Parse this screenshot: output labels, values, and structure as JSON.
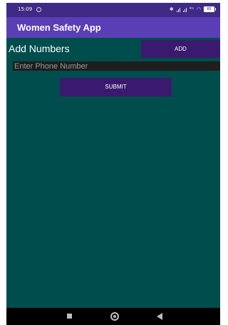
{
  "status_bar": {
    "time": "15:09",
    "battery": "85",
    "icons": [
      "clock-icon",
      "bluetooth-icon",
      "signal-icon",
      "signal-icon",
      "volte-icon",
      "wifi-icon",
      "battery-icon"
    ]
  },
  "app_bar": {
    "title": "Women Safety App",
    "color": "#5a3eb5"
  },
  "main": {
    "add_label": "Add Numbers",
    "add_button": "ADD",
    "phone_input": {
      "value": "",
      "placeholder": "Enter Phone Number"
    },
    "submit_button": "SUBMIT",
    "background": "#004d4d",
    "button_color": "#3a1a6e"
  },
  "nav_bar": {
    "icons": [
      "recents-icon",
      "home-icon",
      "back-icon"
    ]
  }
}
